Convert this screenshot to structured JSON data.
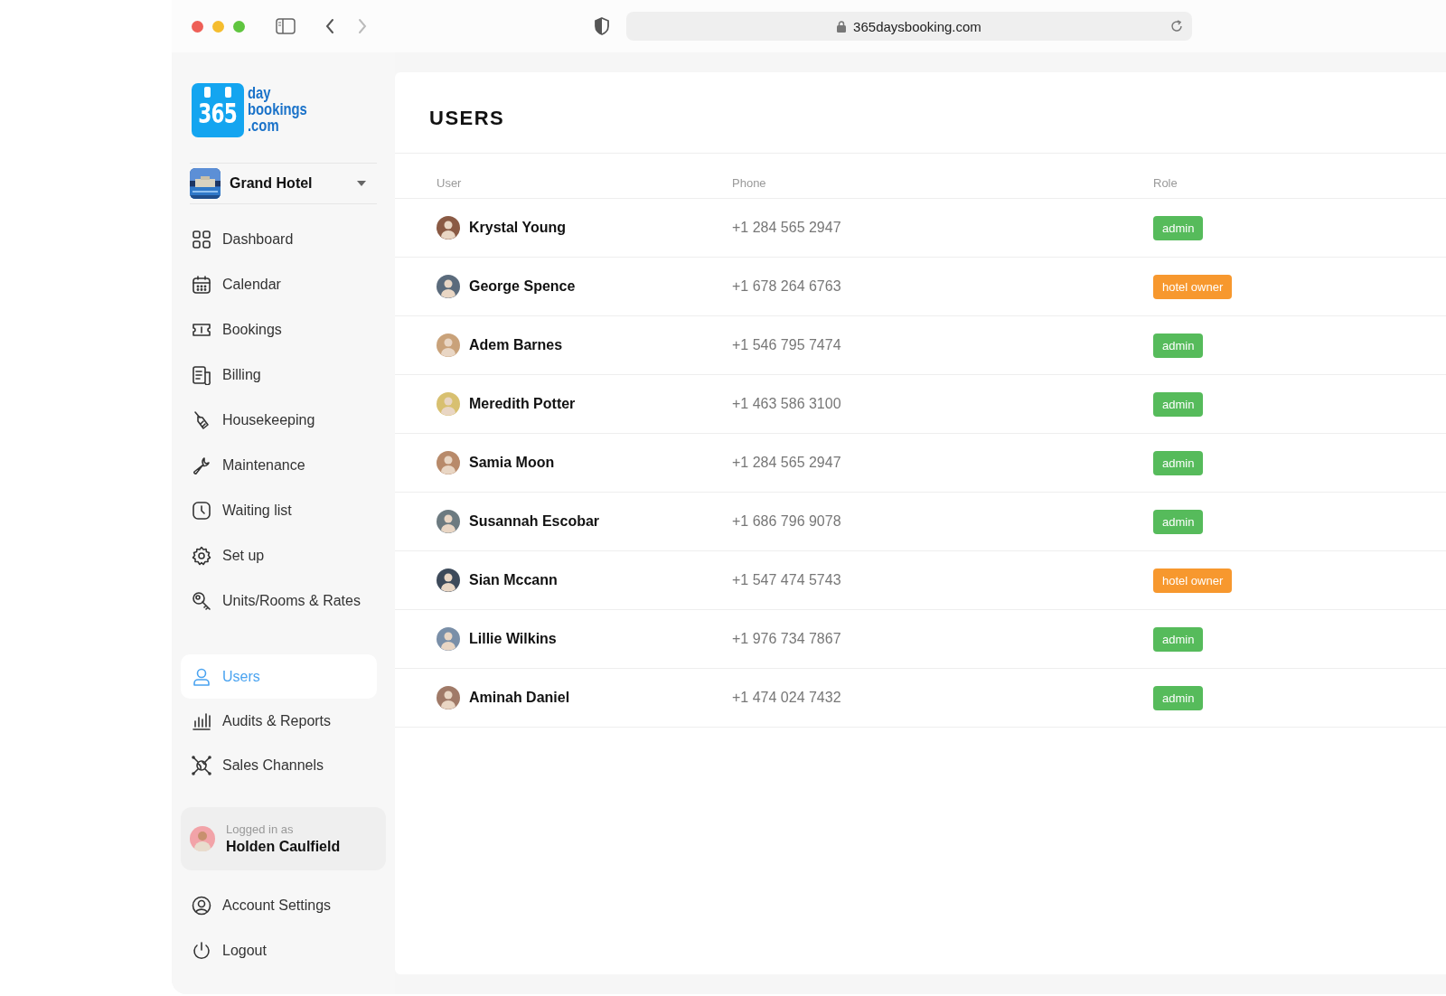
{
  "browser": {
    "url": "365daysbooking.com"
  },
  "sidebar": {
    "logo": {
      "number": "365",
      "lines": [
        "day",
        "bookings",
        ".com"
      ]
    },
    "hotel": {
      "name": "Grand Hotel"
    },
    "nav": [
      {
        "label": "Dashboard",
        "selected": false
      },
      {
        "label": "Calendar",
        "selected": false
      },
      {
        "label": "Bookings",
        "selected": false
      },
      {
        "label": "Billing",
        "selected": false
      },
      {
        "label": "Housekeeping",
        "selected": false
      },
      {
        "label": "Maintenance",
        "selected": false
      },
      {
        "label": "Waiting list",
        "selected": false
      },
      {
        "label": "Set up",
        "selected": false
      },
      {
        "label": "Units/Rooms & Rates",
        "selected": false
      }
    ],
    "nav_secondary": [
      {
        "label": "Users",
        "selected": true
      },
      {
        "label": "Audits & Reports",
        "selected": false
      },
      {
        "label": "Sales Channels",
        "selected": false
      }
    ],
    "session": {
      "caption": "Logged in as",
      "name": "Holden Caulfield"
    },
    "account_menu": [
      "Account Settings",
      "Logout"
    ]
  },
  "page": {
    "title": "USERS",
    "table": {
      "columns": [
        "User",
        "Phone",
        "Role"
      ],
      "rows": [
        {
          "name": "Krystal Young",
          "phone": "+1 284 565 2947",
          "role": {
            "label": "admin",
            "kind": "admin"
          }
        },
        {
          "name": "George Spence",
          "phone": "+1 678 264 6763",
          "role": {
            "label": "hotel owner",
            "kind": "owner"
          }
        },
        {
          "name": "Adem Barnes",
          "phone": "+1 546 795 7474",
          "role": {
            "label": "admin",
            "kind": "admin"
          }
        },
        {
          "name": "Meredith Potter",
          "phone": "+1 463 586 3100",
          "role": {
            "label": "admin",
            "kind": "admin"
          }
        },
        {
          "name": "Samia Moon",
          "phone": "+1 284 565 2947",
          "role": {
            "label": "admin",
            "kind": "admin"
          }
        },
        {
          "name": "Susannah Escobar",
          "phone": "+1 686 796 9078",
          "role": {
            "label": "admin",
            "kind": "admin"
          }
        },
        {
          "name": "Sian Mccann",
          "phone": "+1 547 474 5743",
          "role": {
            "label": "hotel owner",
            "kind": "owner"
          }
        },
        {
          "name": "Lillie Wilkins",
          "phone": "+1 976 734 7867",
          "role": {
            "label": "admin",
            "kind": "admin"
          }
        },
        {
          "name": "Aminah Daniel",
          "phone": "+1 474 024 7432",
          "role": {
            "label": "admin",
            "kind": "admin"
          }
        }
      ]
    }
  }
}
